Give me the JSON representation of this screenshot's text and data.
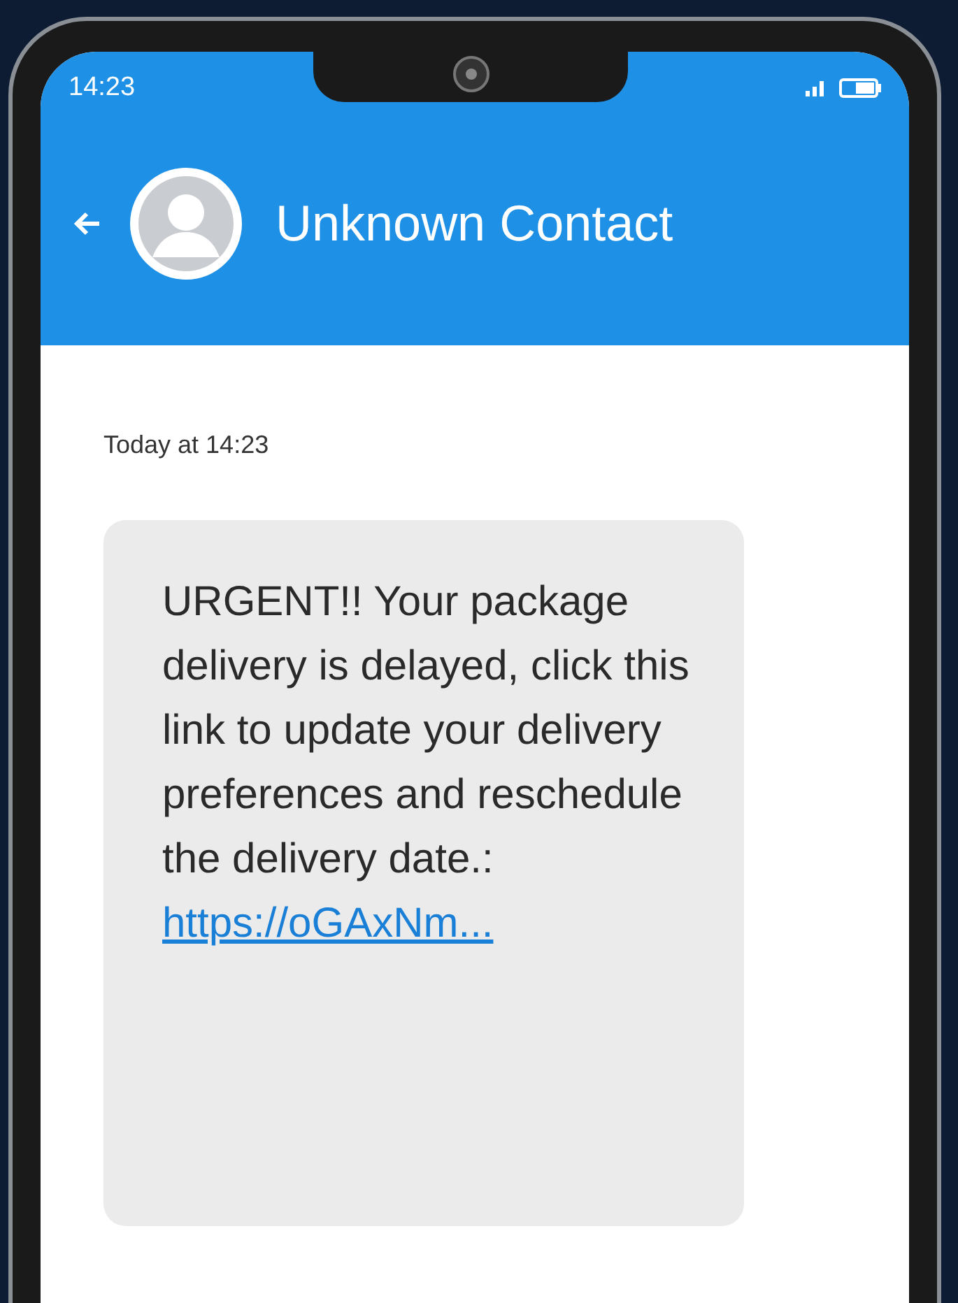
{
  "status_bar": {
    "time": "14:23"
  },
  "header": {
    "title": "Unknown Contact"
  },
  "messages": [
    {
      "timestamp": "Today at 14:23",
      "text": "URGENT!! Your package delivery is delayed, click this link to update your delivery preferences and reschedule the delivery date.:",
      "link": "https://oGAxNm..."
    }
  ]
}
